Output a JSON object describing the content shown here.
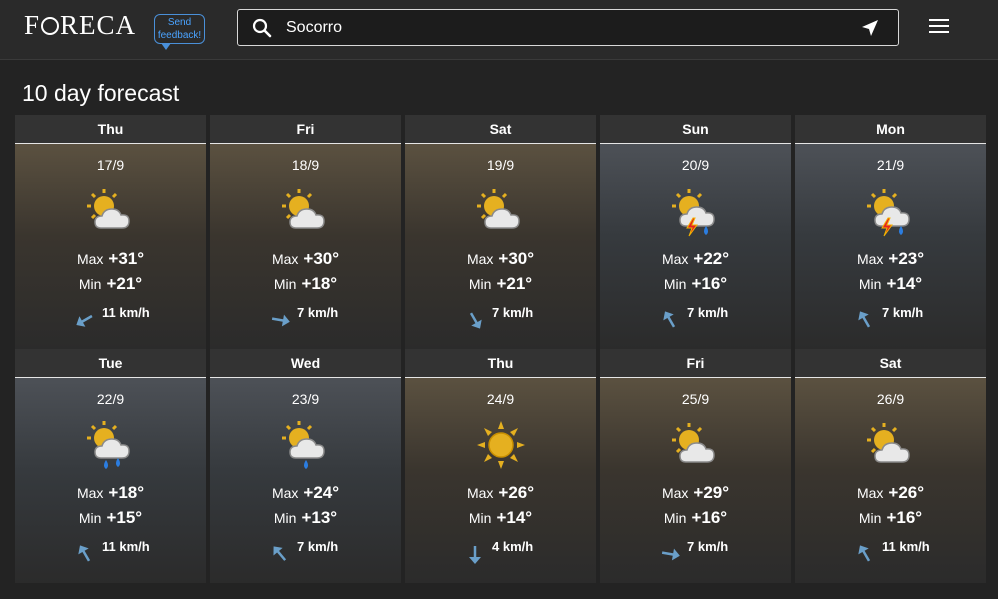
{
  "header": {
    "logo": "FORECA",
    "feedback": "Send feedback!",
    "search_value": "Socorro"
  },
  "title": "10 day forecast",
  "labels": {
    "max": "Max",
    "min": "Min"
  },
  "days": [
    {
      "day": "Thu",
      "date": "17/9",
      "icon": "partly-cloudy-icon",
      "max": "+31°",
      "min": "+21°",
      "wind": "11 km/h",
      "wind_dir": 240,
      "theme": "warm"
    },
    {
      "day": "Fri",
      "date": "18/9",
      "icon": "partly-cloudy-icon",
      "max": "+30°",
      "min": "+18°",
      "wind": "7 km/h",
      "wind_dir": 100,
      "theme": "warm"
    },
    {
      "day": "Sat",
      "date": "19/9",
      "icon": "partly-cloudy-icon",
      "max": "+30°",
      "min": "+21°",
      "wind": "7 km/h",
      "wind_dir": 150,
      "theme": "warm"
    },
    {
      "day": "Sun",
      "date": "20/9",
      "icon": "thunderstorm-icon",
      "max": "+22°",
      "min": "+16°",
      "wind": "7 km/h",
      "wind_dir": 330,
      "theme": "cool"
    },
    {
      "day": "Mon",
      "date": "21/9",
      "icon": "thunderstorm-icon",
      "max": "+23°",
      "min": "+14°",
      "wind": "7 km/h",
      "wind_dir": 330,
      "theme": "cool"
    },
    {
      "day": "Tue",
      "date": "22/9",
      "icon": "rain-showers-icon",
      "max": "+18°",
      "min": "+15°",
      "wind": "11 km/h",
      "wind_dir": 330,
      "theme": "cool"
    },
    {
      "day": "Wed",
      "date": "23/9",
      "icon": "rain-shower-icon",
      "max": "+24°",
      "min": "+13°",
      "wind": "7 km/h",
      "wind_dir": 320,
      "theme": "cool"
    },
    {
      "day": "Thu",
      "date": "24/9",
      "icon": "sun-icon",
      "max": "+26°",
      "min": "+14°",
      "wind": "4 km/h",
      "wind_dir": 180,
      "theme": "warm"
    },
    {
      "day": "Fri",
      "date": "25/9",
      "icon": "partly-cloudy-icon",
      "max": "+29°",
      "min": "+16°",
      "wind": "7 km/h",
      "wind_dir": 100,
      "theme": "warm"
    },
    {
      "day": "Sat",
      "date": "26/9",
      "icon": "partly-cloudy-icon",
      "max": "+26°",
      "min": "+16°",
      "wind": "11 km/h",
      "wind_dir": 330,
      "theme": "warm"
    }
  ]
}
